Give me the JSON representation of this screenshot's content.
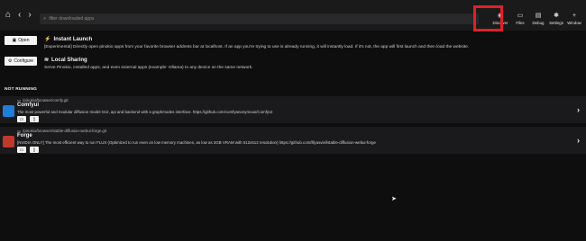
{
  "topbar": {
    "nav_icons": [
      "home-icon",
      "back-icon",
      "forward-icon"
    ],
    "search_placeholder": "filter downloaded apps",
    "tools": [
      {
        "label": "Discover",
        "icon": "discover-icon"
      },
      {
        "label": "Files",
        "icon": "folder-icon"
      },
      {
        "label": "Debug",
        "icon": "debug-icon"
      },
      {
        "label": "Settings",
        "icon": "gear-icon"
      },
      {
        "label": "Window",
        "icon": "plus-icon"
      }
    ],
    "highlight_color": "#e0202a"
  },
  "launch": {
    "instant": {
      "button_label": "Open",
      "title": "Instant Launch",
      "description": "[Experimental] Directly open pinokio apps from your favorite browser address bar at localhost. If an app you're trying to use is already running, it will instantly load. If it's not, the app will first launch and then load the website."
    },
    "sharing": {
      "button_label": "Configure",
      "title": "Local Sharing",
      "description": "Serve Pinokio, installed apps, and even external apps (example: Ollama) to any device on the same network."
    }
  },
  "section": {
    "label": "NOT RUNNING"
  },
  "apps": [
    {
      "path": "/pinokio/browser/comfy.git",
      "title": "Comfyui",
      "description": "The most powerful and modular diffusion model GUI, api and backend with a graph/nodes interface. https://github.com/comfyanonymous/ComfyUI",
      "thumb_color": "#1e7fd8"
    },
    {
      "path": "/pinokio/browser/stable-diffusion-webui-forge.git",
      "title": "Forge",
      "description": "[NVIDIA ONLY] The most efficient way to run FLUX (Optimized to run even on low memory machines, as low as 3GB VRAM with 512x512 resolution) https://github.com/lllyasviel/stable-diffusion-webui-forge",
      "thumb_color": "#c0392b"
    }
  ]
}
